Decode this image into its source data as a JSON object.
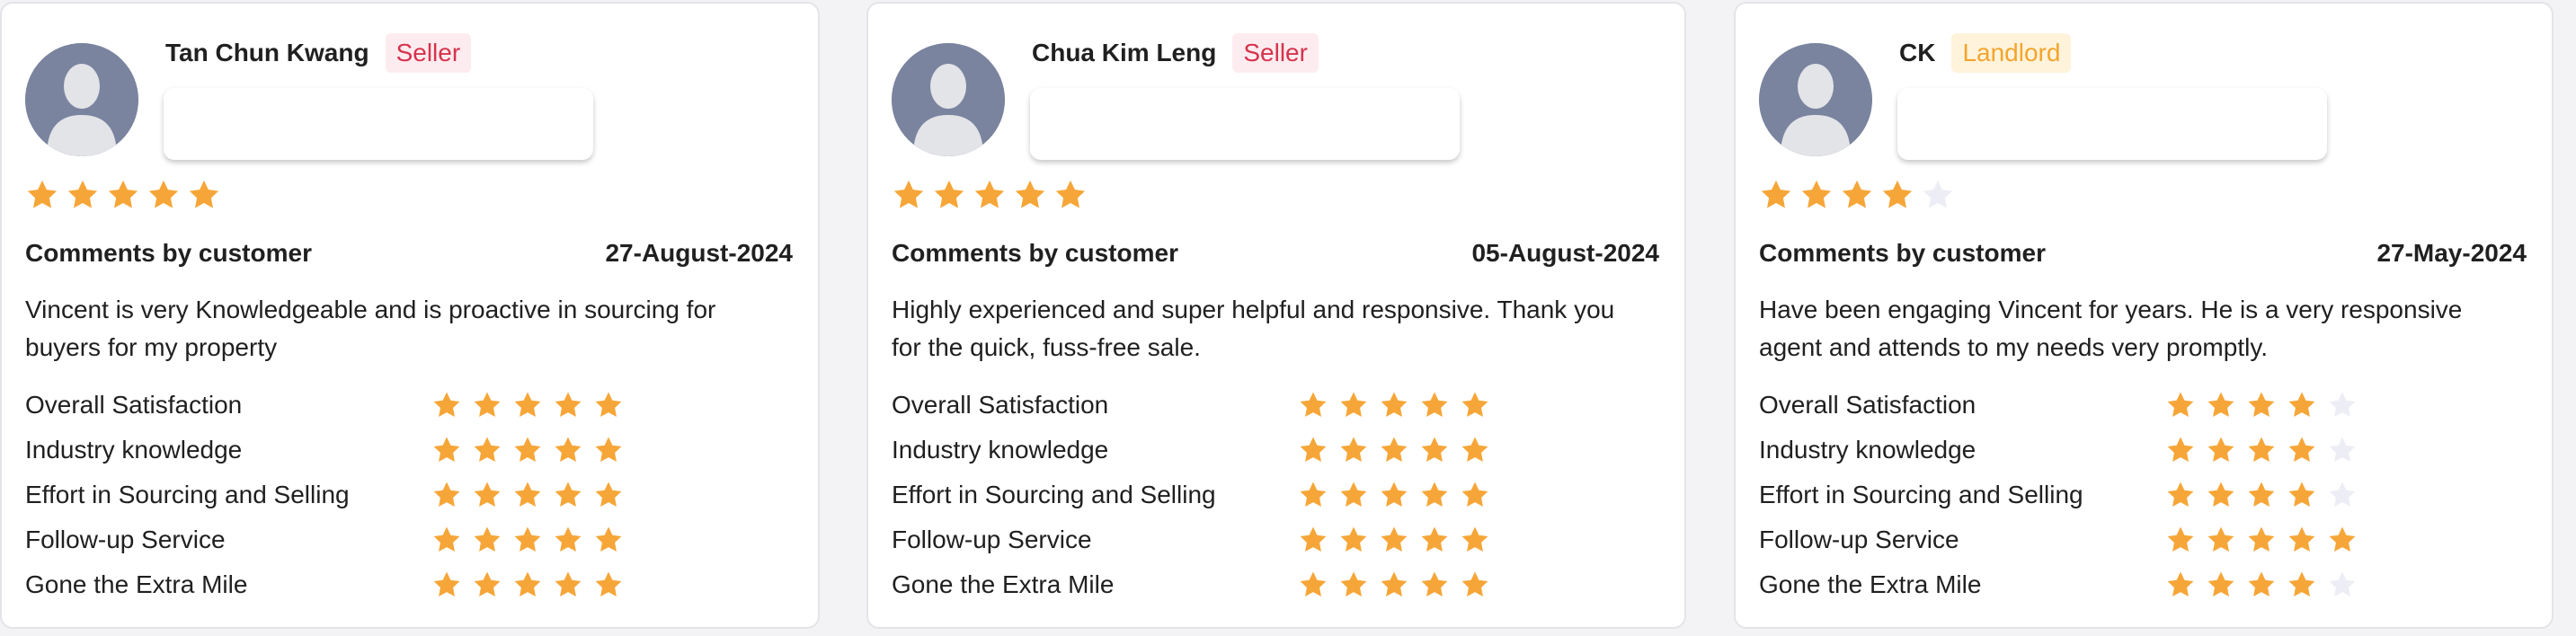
{
  "colors": {
    "star_filled": "#F6A638",
    "star_empty": "#EDEEF5",
    "seller_badge_text": "#D6334D",
    "landlord_badge_text": "#F3A52C",
    "avatar_bg": "#7A849F"
  },
  "reviews": [
    {
      "name": "Tan Chun Kwang",
      "role": "Seller",
      "rating": 5,
      "comments_heading": "Comments by customer",
      "date": "27-August-2024",
      "comment": "Vincent is very Knowledgeable and is proactive in sourcing for buyers for my property",
      "criteria": [
        {
          "label": "Overall Satisfaction",
          "rating": 5
        },
        {
          "label": "Industry knowledge",
          "rating": 5
        },
        {
          "label": "Effort in Sourcing and Selling",
          "rating": 5
        },
        {
          "label": "Follow-up Service",
          "rating": 5
        },
        {
          "label": "Gone the Extra Mile",
          "rating": 5
        }
      ]
    },
    {
      "name": "Chua Kim Leng",
      "role": "Seller",
      "rating": 5,
      "comments_heading": "Comments by customer",
      "date": "05-August-2024",
      "comment": "Highly experienced and super helpful and responsive. Thank you for the quick, fuss-free sale.",
      "criteria": [
        {
          "label": "Overall Satisfaction",
          "rating": 5
        },
        {
          "label": "Industry knowledge",
          "rating": 5
        },
        {
          "label": "Effort in Sourcing and Selling",
          "rating": 5
        },
        {
          "label": "Follow-up Service",
          "rating": 5
        },
        {
          "label": "Gone the Extra Mile",
          "rating": 5
        }
      ]
    },
    {
      "name": "CK",
      "role": "Landlord",
      "rating": 4,
      "comments_heading": "Comments by customer",
      "date": "27-May-2024",
      "comment": "Have been engaging Vincent for years. He is a very responsive agent and attends to my needs very promptly.",
      "criteria": [
        {
          "label": "Overall Satisfaction",
          "rating": 4
        },
        {
          "label": "Industry knowledge",
          "rating": 4
        },
        {
          "label": "Effort in Sourcing and Selling",
          "rating": 4
        },
        {
          "label": "Follow-up Service",
          "rating": 5
        },
        {
          "label": "Gone the Extra Mile",
          "rating": 4
        }
      ]
    }
  ]
}
